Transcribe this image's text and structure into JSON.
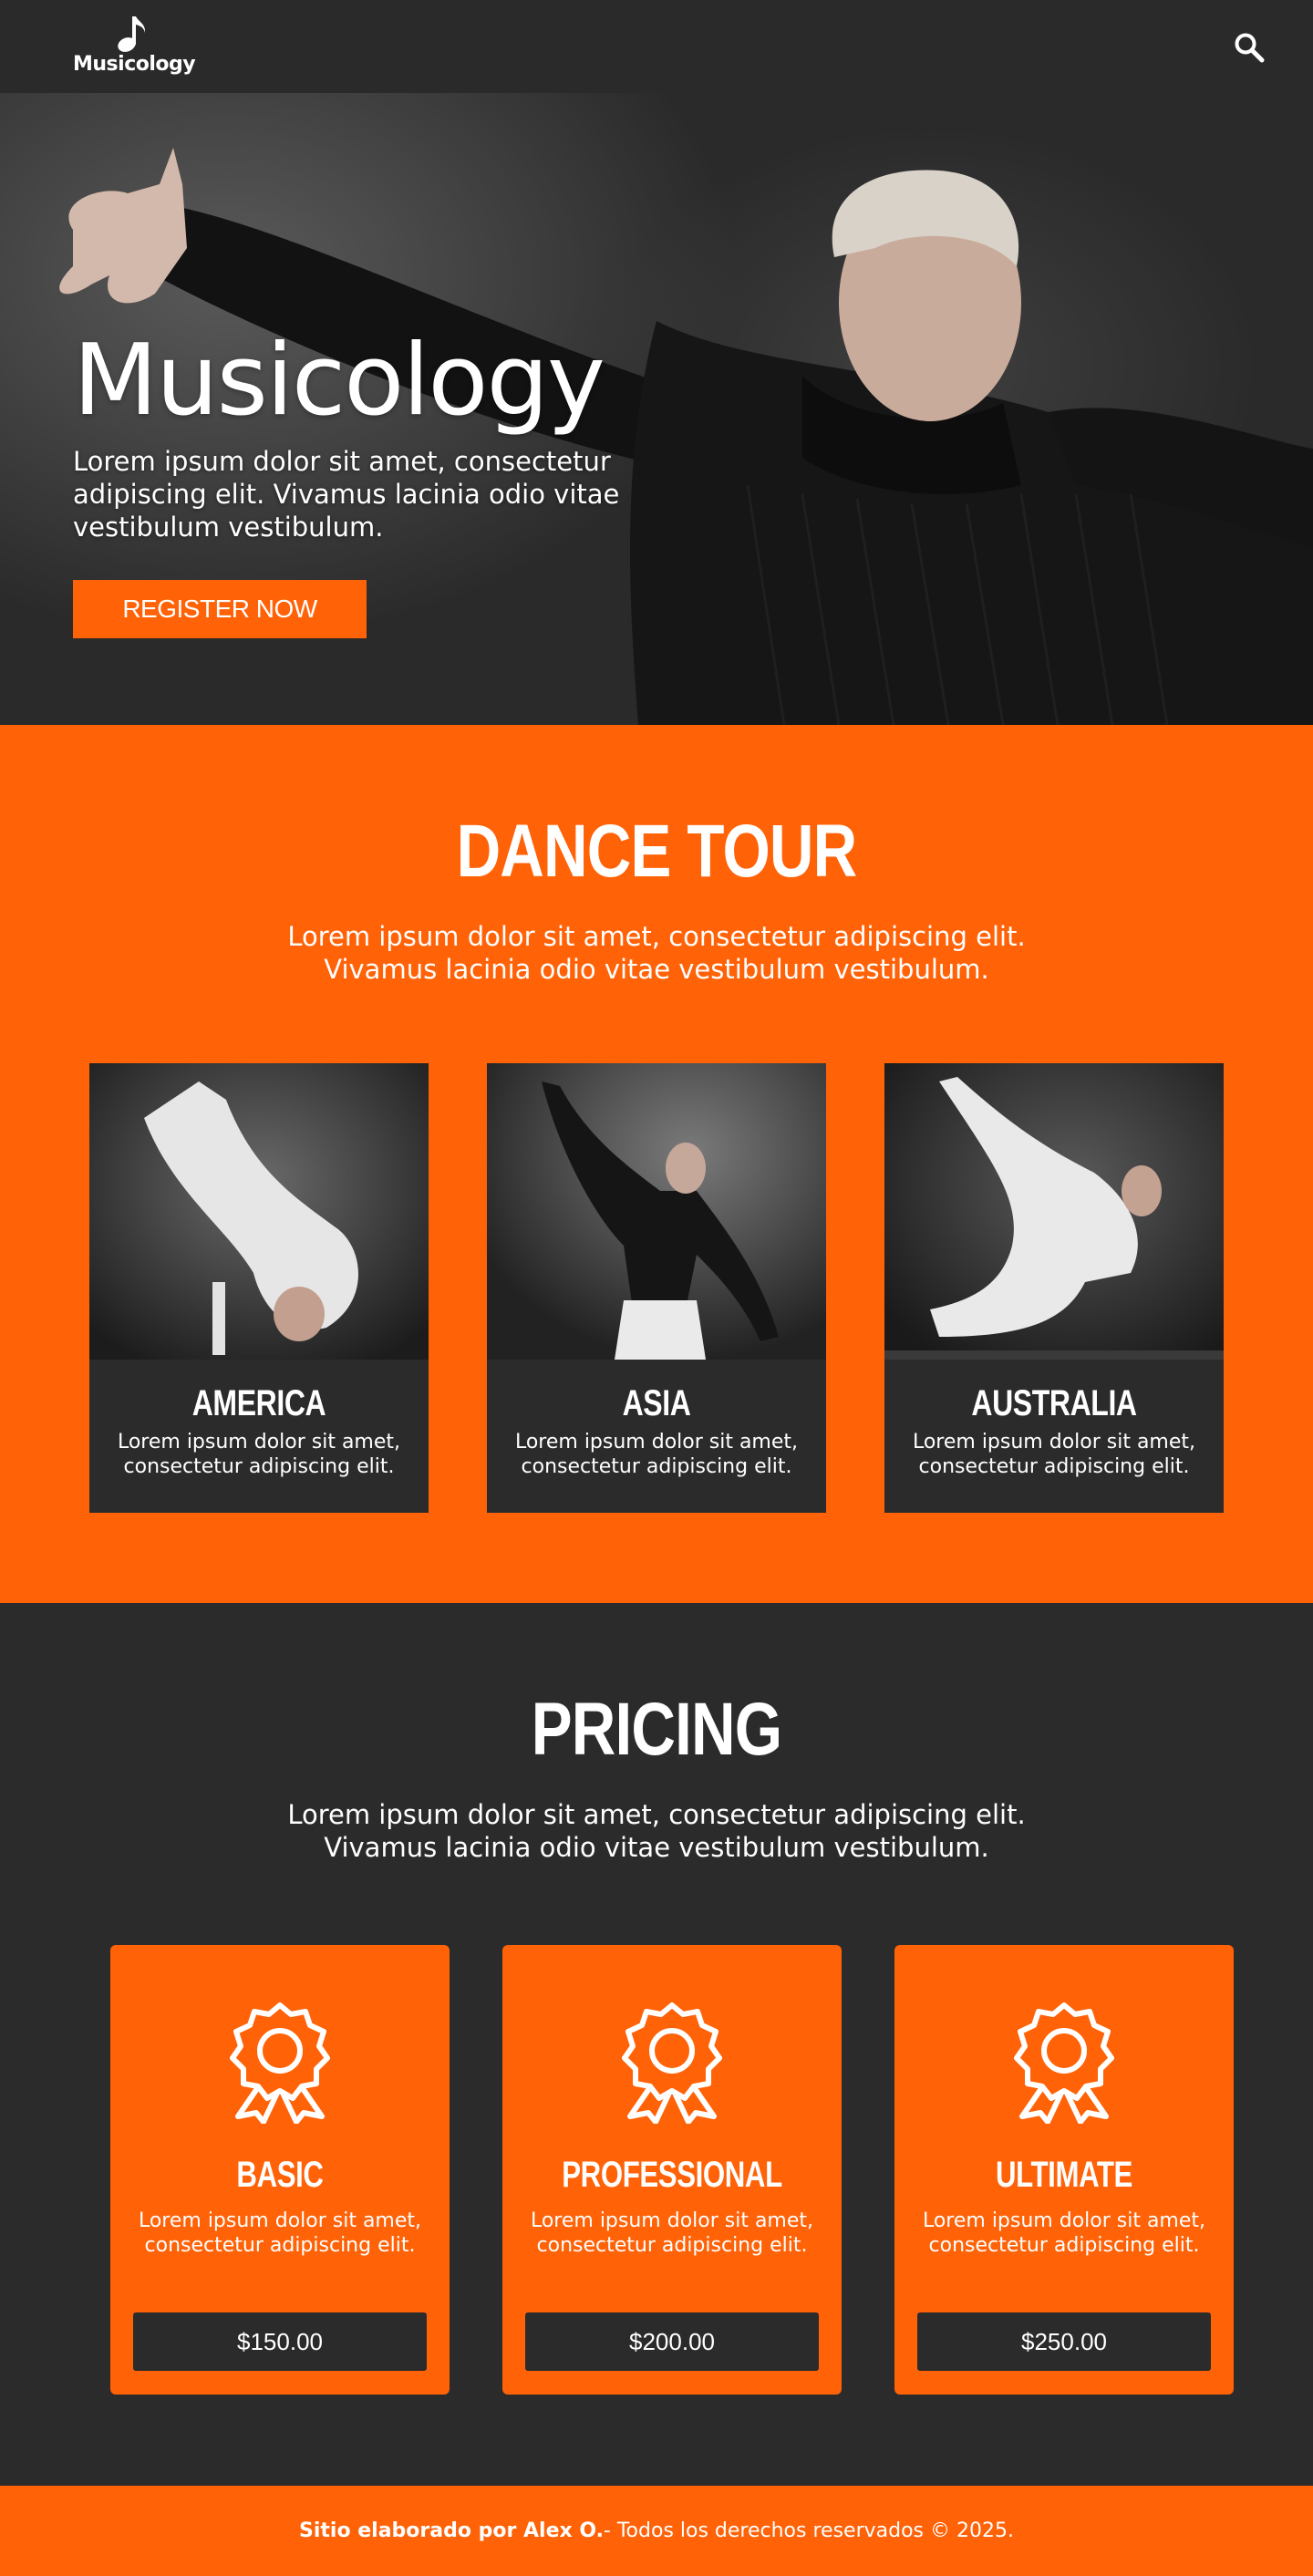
{
  "nav": {
    "logo_text": "Musicology",
    "logo_icon": "music-note-icon",
    "search_icon": "search-icon"
  },
  "hero": {
    "title": "Musicology",
    "description": "Lorem ipsum dolor sit amet, consectetur adipiscing elit. Vivamus lacinia odio vitae vestibulum vestibulum.",
    "button_label": "REGISTER NOW"
  },
  "tour": {
    "title": "DANCE TOUR",
    "description": "Lorem ipsum dolor sit amet, consectetur adipiscing elit. Vivamus lacinia odio vitae vestibulum vestibulum.",
    "cards": [
      {
        "name": "AMERICA",
        "text": "Lorem ipsum dolor sit amet, consectetur adipiscing elit."
      },
      {
        "name": "ASIA",
        "text": "Lorem ipsum dolor sit amet, consectetur adipiscing elit."
      },
      {
        "name": "AUSTRALIA",
        "text": "Lorem ipsum dolor sit amet, consectetur adipiscing elit."
      }
    ]
  },
  "pricing": {
    "title": "PRICING",
    "description": "Lorem ipsum dolor sit amet, consectetur adipiscing elit. Vivamus lacinia odio vitae vestibulum vestibulum.",
    "plans": [
      {
        "name": "BASIC",
        "text": "Lorem ipsum dolor sit amet, consectetur adipiscing elit.",
        "price": "$150.00",
        "icon": "award-ribbon-icon"
      },
      {
        "name": "PROFESSIONAL",
        "text": "Lorem ipsum dolor sit amet, consectetur adipiscing elit.",
        "price": "$200.00",
        "icon": "award-ribbon-icon"
      },
      {
        "name": "ULTIMATE",
        "text": "Lorem ipsum dolor sit amet, consectetur adipiscing elit.",
        "price": "$250.00",
        "icon": "award-ribbon-icon"
      }
    ]
  },
  "footer": {
    "author": "Sitio elaborado por Alex O.",
    "rights": " - Todos los derechos reservados © 2025."
  },
  "colors": {
    "accent": "#ff6207",
    "dark": "#2b2b2b",
    "text": "#ffffff"
  }
}
